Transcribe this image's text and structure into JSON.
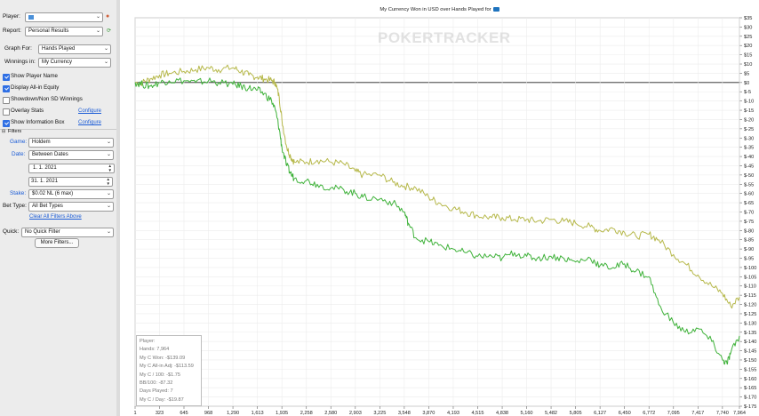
{
  "sidebar": {
    "player_label": "Player:",
    "player_value": "",
    "report_label": "Report:",
    "report_value": "Personal Results",
    "graph_for_label": "Graph For:",
    "graph_for_value": "Hands Played",
    "winnings_in_label": "Winnings in:",
    "winnings_in_value": "My Currency",
    "options": [
      {
        "label": "Show Player Name",
        "checked": true
      },
      {
        "label": "Display All-in Equity",
        "checked": true
      },
      {
        "label": "Showdown/Non SD Winnings",
        "checked": false
      },
      {
        "label": "Overlay Stats",
        "checked": false
      },
      {
        "label": "Show Information Box",
        "checked": true
      }
    ],
    "configure_label": "Configure",
    "filters_label": "Filters",
    "game_label": "Game:",
    "game_value": "Holdem",
    "date_label": "Date:",
    "date_value": "Between Dates",
    "date_from": "1.  1. 2021",
    "date_to": "31.  1. 2021",
    "stake_label": "Stake:",
    "stake_value": "$0.02 NL (6 max)",
    "bet_type_label": "Bet Type:",
    "bet_type_value": "All Bet Types",
    "clear_filters": "Clear All Filters Above",
    "quick_label": "Quick:",
    "quick_value": "No Quick Filter",
    "more_filters": "More Filters..."
  },
  "chart_data": {
    "type": "line",
    "title": "My Currency Won in USD over Hands Played for",
    "watermark": "POKERTRACKER",
    "xlabel": "",
    "ylabel": "",
    "xlim": [
      1,
      7964
    ],
    "ylim": [
      -175,
      35
    ],
    "x_ticks": [
      "1",
      "323",
      "645",
      "968",
      "1,290",
      "1,613",
      "1,935",
      "2,258",
      "2,580",
      "2,903",
      "3,225",
      "3,548",
      "3,870",
      "4,193",
      "4,515",
      "4,838",
      "5,160",
      "5,482",
      "5,805",
      "6,127",
      "6,450",
      "6,772",
      "7,095",
      "7,417",
      "7,740",
      "7,964"
    ],
    "y_ticks": [
      "$35",
      "$30",
      "$25",
      "$20",
      "$15",
      "$10",
      "$5",
      "$0",
      "$-5",
      "$-10",
      "$-15",
      "$-20",
      "$-25",
      "$-30",
      "$-35",
      "$-40",
      "$-45",
      "$-50",
      "$-55",
      "$-60",
      "$-65",
      "$-70",
      "$-75",
      "$-80",
      "$-85",
      "$-90",
      "$-95",
      "$-100",
      "$-105",
      "$-110",
      "$-115",
      "$-120",
      "$-125",
      "$-130",
      "$-135",
      "$-140",
      "$-145",
      "$-150",
      "$-155",
      "$-160",
      "$-165",
      "$-170",
      "$-175"
    ],
    "grid": true,
    "series": [
      {
        "color": "#b6b84a",
        "x": [
          1,
          100,
          200,
          323,
          450,
          645,
          800,
          968,
          1100,
          1290,
          1400,
          1500,
          1613,
          1700,
          1800,
          1850,
          1900,
          1935,
          2000,
          2050,
          2100,
          2258,
          2400,
          2580,
          2750,
          2903,
          3000,
          3225,
          3400,
          3548,
          3700,
          3870,
          4000,
          4193,
          4350,
          4515,
          4700,
          4838,
          5000,
          5160,
          5300,
          5482,
          5650,
          5805,
          6000,
          6127,
          6300,
          6450,
          6600,
          6772,
          6900,
          7095,
          7250,
          7417,
          7600,
          7740,
          7850,
          7964
        ],
        "values": [
          0,
          0,
          2,
          4,
          5,
          6,
          7,
          8,
          7,
          8,
          6,
          4,
          3,
          2,
          1,
          0,
          -8,
          -20,
          -35,
          -40,
          -43,
          -43,
          -42,
          -43,
          -44,
          -48,
          -50,
          -50,
          -54,
          -56,
          -57,
          -62,
          -65,
          -68,
          -70,
          -72,
          -73,
          -73,
          -74,
          -74,
          -75,
          -74,
          -75,
          -76,
          -78,
          -80,
          -79,
          -81,
          -83,
          -82,
          -85,
          -93,
          -98,
          -104,
          -110,
          -114,
          -121,
          -116
        ]
      },
      {
        "color": "#3fb23a",
        "x": [
          1,
          100,
          200,
          323,
          450,
          645,
          800,
          968,
          1100,
          1290,
          1400,
          1500,
          1613,
          1700,
          1800,
          1850,
          1900,
          1935,
          2000,
          2050,
          2100,
          2258,
          2400,
          2580,
          2750,
          2903,
          3000,
          3225,
          3400,
          3548,
          3600,
          3700,
          3870,
          4000,
          4193,
          4350,
          4515,
          4700,
          4838,
          5000,
          5160,
          5300,
          5482,
          5650,
          5805,
          6000,
          6127,
          6300,
          6450,
          6600,
          6772,
          6900,
          7095,
          7250,
          7417,
          7600,
          7740,
          7800,
          7850,
          7964
        ],
        "values": [
          0,
          -1,
          -2,
          0,
          1,
          1,
          0,
          1,
          0,
          -1,
          -2,
          -3,
          -4,
          -6,
          -10,
          -15,
          -25,
          -35,
          -45,
          -49,
          -52,
          -53,
          -55,
          -57,
          -58,
          -60,
          -62,
          -63,
          -65,
          -70,
          -76,
          -84,
          -86,
          -88,
          -90,
          -92,
          -94,
          -94,
          -95,
          -92,
          -94,
          -95,
          -94,
          -95,
          -97,
          -95,
          -99,
          -100,
          -98,
          -102,
          -105,
          -120,
          -130,
          -135,
          -133,
          -140,
          -150,
          -152,
          -146,
          -137
        ]
      }
    ],
    "info_box": [
      "Player:",
      "Hands: 7,964",
      "My C Won: -$139.09",
      "My C All-in Adj: -$113.59",
      "My C / 100: -$1.75",
      "BB/100: -87.32",
      "Days Played: 7",
      "My C / Day: -$19.87"
    ]
  }
}
